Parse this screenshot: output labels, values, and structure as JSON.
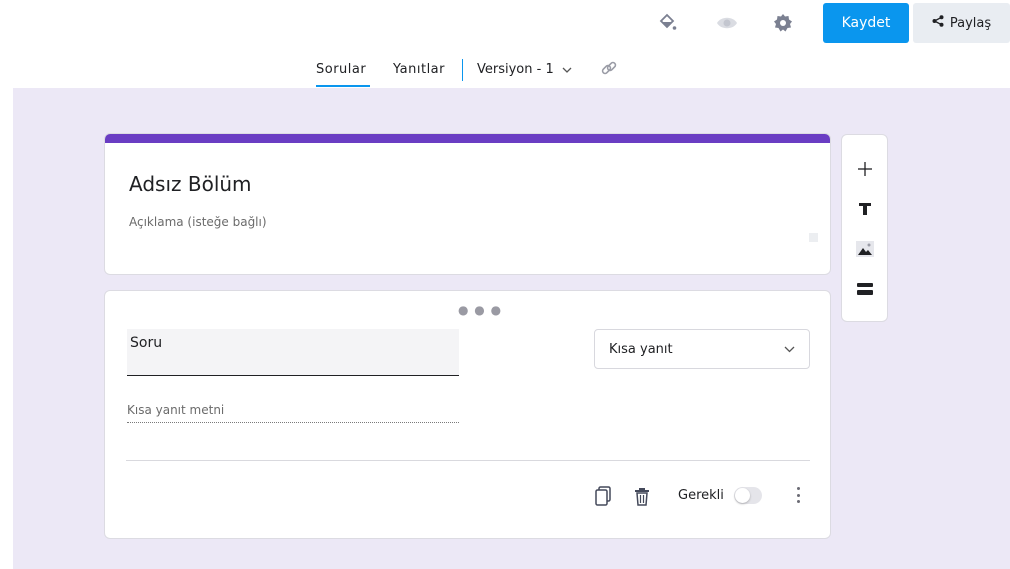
{
  "topbar": {
    "save_label": "Kaydet",
    "share_label": "Paylaş"
  },
  "tabs": {
    "questions_label": "Sorular",
    "responses_label": "Yanıtlar",
    "version_label": "Versiyon - 1"
  },
  "section": {
    "title": "Adsız Bölüm",
    "description_placeholder": "Açıklama (isteğe bağlı)"
  },
  "question": {
    "title": "Soru",
    "type_value": "Kısa yanıt",
    "short_answer_placeholder": "Kısa yanıt metni",
    "required_label": "Gerekli",
    "required": false
  },
  "colors": {
    "accent_blue": "#0a96ee",
    "section_accent": "#6a3dc3",
    "canvas_bg": "#ece8f6"
  },
  "icons": {
    "topbar": [
      "paint-bucket-icon",
      "eye-icon",
      "gear-icon",
      "share-icon"
    ],
    "tabs": [
      "chevron-down-icon",
      "link-icon"
    ],
    "question": [
      "drag-handle-icon",
      "chevron-down-icon",
      "copy-icon",
      "trash-icon",
      "more-vert-icon"
    ],
    "toolbox": [
      "plus-icon",
      "text-icon",
      "image-icon",
      "section-icon"
    ]
  }
}
